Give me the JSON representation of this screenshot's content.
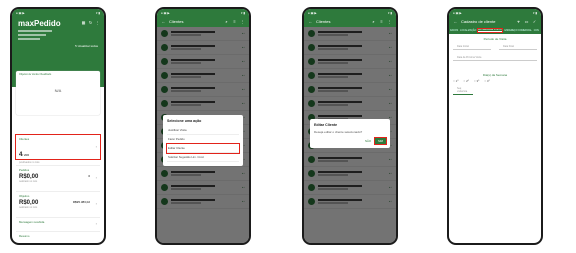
{
  "phone1": {
    "app_name": "maxPedido",
    "summary_label": "Objetivo de Venda / Realizado",
    "na_value": "N/A",
    "refresh_label": "Atualizar todos",
    "cards": [
      {
        "label": "Clientes",
        "value": "4",
        "sub": "/ 206",
        "note": "positivados no mês",
        "highlight": true
      },
      {
        "label": "Pedidos",
        "value": "R$0,00",
        "extra": "0",
        "note": "realizado no mês"
      },
      {
        "label": "Objetivo",
        "value": "R$0,00",
        "extra": "R$95.383,02",
        "note": "realizado no mês"
      },
      {
        "label": "Mensagem recebida",
        "value": "",
        "extra": "",
        "note": ""
      },
      {
        "label": "Resumo",
        "value": "",
        "extra": "",
        "note": ""
      }
    ]
  },
  "phone2": {
    "title": "Clientes",
    "dialog_title": "Selecione uma ação",
    "options": [
      "Justificar Visita",
      "Fazer Pedido",
      "Editar Cliente",
      "Solicitar Sugestão Lim. Créd."
    ],
    "highlight_index": 2,
    "rows": 13
  },
  "phone3": {
    "title": "Clientes",
    "dialog_title": "Editar Cliente",
    "dialog_text": "Deseja editar o cliente selecionado?",
    "no_label": "NÃO",
    "yes_label": "SIM",
    "rows": 13
  },
  "phone4": {
    "title": "Cadastro de cliente",
    "tabs": [
      "DADOS",
      "LOCALIZAÇÃO",
      "ENTREGA/DE VISITAS",
      "ENDEREÇO COMERCIAL",
      "CON"
    ],
    "selected_tab": 2,
    "section1": "Período de Visita",
    "fields": [
      "Data Inicial",
      "Data Final",
      "Data da Próxima Visita"
    ],
    "section2": "Dia(s) da Semana",
    "radio_labels": [
      "1º",
      "2º",
      "3º",
      "4º"
    ],
    "field_last": "Seq visita/rota"
  }
}
